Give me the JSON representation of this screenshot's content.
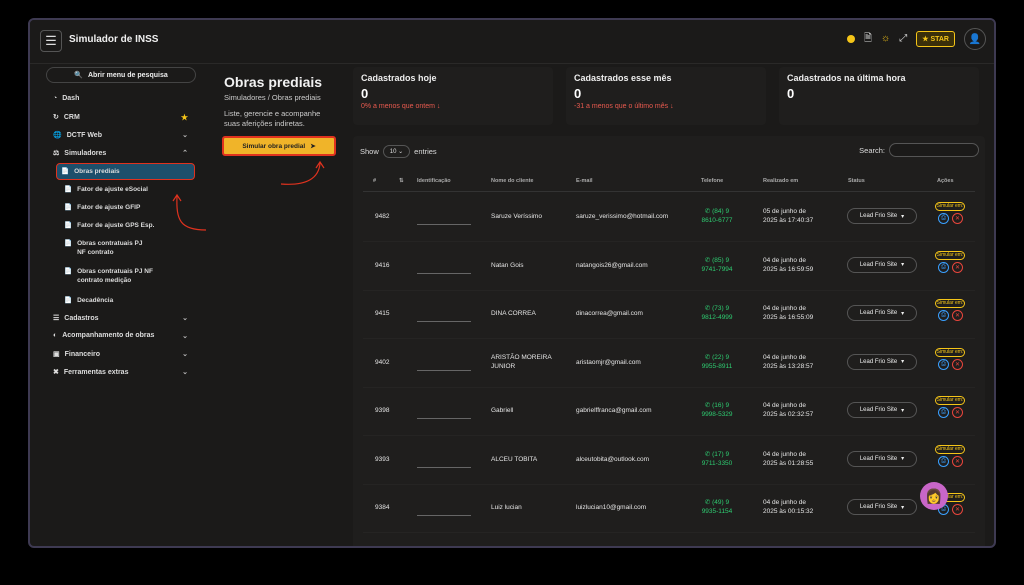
{
  "app_title": "Simulador de INSS",
  "topbar": {
    "star_label": "STAR"
  },
  "sidebar": {
    "search_label": "Abrir menu de pesquisa",
    "items": [
      {
        "label": "Dash"
      },
      {
        "label": "CRM"
      },
      {
        "label": "DCTF Web"
      },
      {
        "label": "Simuladores"
      },
      {
        "label": "Cadastros"
      },
      {
        "label": "Acompanhamento de obras"
      },
      {
        "label": "Financeiro"
      },
      {
        "label": "Ferramentas extras"
      }
    ],
    "sub_items": [
      {
        "label": "Obras prediais"
      },
      {
        "label": "Fator de ajuste eSocial"
      },
      {
        "label": "Fator de ajuste GFIP"
      },
      {
        "label": "Fator de ajuste GPS Esp."
      },
      {
        "label": "Obras contratuais PJ NF contrato"
      },
      {
        "label": "Obras contratuais PJ NF contrato medição"
      },
      {
        "label": "Decadência"
      }
    ]
  },
  "page": {
    "title": "Obras prediais",
    "breadcrumb": "Simuladores / Obras prediais",
    "description": "Liste, gerencie e acompanhe suas aferições indiretas.",
    "simulate_button": "Simular obra predial"
  },
  "stats": [
    {
      "label": "Cadastrados hoje",
      "value": "0",
      "change": "0% a menos que ontem"
    },
    {
      "label": "Cadastrados esse mês",
      "value": "0",
      "change": "-31 a menos que o último mês"
    },
    {
      "label": "Cadastrados na última hora",
      "value": "0",
      "change": ""
    }
  ],
  "table": {
    "show_label": "Show",
    "entries_value": "10",
    "entries_label": "entries",
    "search_label": "Search:",
    "headers": [
      "#",
      "Identificação",
      "Nome do cliente",
      "E-mail",
      "Telefone",
      "Realizado em",
      "Status",
      "Ações"
    ],
    "status_value": "Lead Frio Site",
    "action_badge": "Simular em:",
    "rows": [
      {
        "id": "9482",
        "name": "Saruze Veríssimo",
        "email": "saruze_verissimo@hotmail.com",
        "phone1": "(84) 9",
        "phone2": "8610-6777",
        "date1": "05 de junho de",
        "date2": "2025 às 17:40:37"
      },
      {
        "id": "9416",
        "name": "Natan Gois",
        "email": "natangois26@gmail.com",
        "phone1": "(85) 9",
        "phone2": "9741-7994",
        "date1": "04 de junho de",
        "date2": "2025 às 16:59:59"
      },
      {
        "id": "9415",
        "name": "DINA CORREA",
        "email": "dinacorrea@gmail.com",
        "phone1": "(73) 9",
        "phone2": "9812-4999",
        "date1": "04 de junho de",
        "date2": "2025 às 16:55:09"
      },
      {
        "id": "9402",
        "name": "ARISTÃO MOREIRA JUNIOR",
        "email": "aristaomjr@gmail.com",
        "phone1": "(22) 9",
        "phone2": "9955-8911",
        "date1": "04 de junho de",
        "date2": "2025 às 13:28:57"
      },
      {
        "id": "9398",
        "name": "Gabriell",
        "email": "gabrielffranca@gmail.com",
        "phone1": "(16) 9",
        "phone2": "9998-5329",
        "date1": "04 de junho de",
        "date2": "2025 às 02:32:57"
      },
      {
        "id": "9393",
        "name": "ALCEU TOBITA",
        "email": "alceutobita@outlook.com",
        "phone1": "(17) 9",
        "phone2": "9711-3350",
        "date1": "04 de junho de",
        "date2": "2025 às 01:28:55"
      },
      {
        "id": "9384",
        "name": "Luiz lucian",
        "email": "luizlucian10@gmail.com",
        "phone1": "(49) 9",
        "phone2": "9935-1154",
        "date1": "04 de junho de",
        "date2": "2025 às 00:15:32"
      }
    ]
  }
}
